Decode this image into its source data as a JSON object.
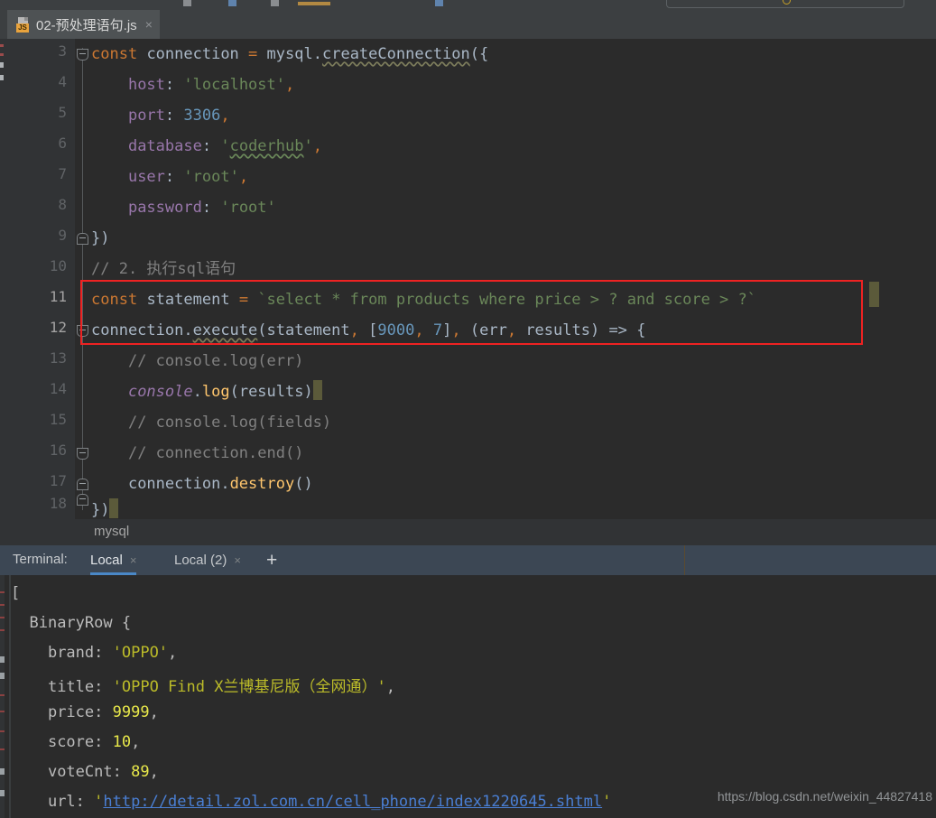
{
  "window": {
    "theme_bg": "#2b2b2b",
    "accent": "#4a88c7",
    "highlight_box_color": "#ee2222"
  },
  "tab": {
    "label": "02-预处理语句.js",
    "icon": "js-file-icon",
    "badge": "JS",
    "close": "×"
  },
  "editor": {
    "first_line_number": 3,
    "lines": [
      {
        "no": "3",
        "fold": "down",
        "text": "const connection = mysql.createConnection({"
      },
      {
        "no": "4",
        "fold": "",
        "text": "    host: 'localhost',"
      },
      {
        "no": "5",
        "fold": "",
        "text": "    port: 3306,"
      },
      {
        "no": "6",
        "fold": "",
        "text": "    database: 'coderhub',"
      },
      {
        "no": "7",
        "fold": "",
        "text": "    user: 'root',"
      },
      {
        "no": "8",
        "fold": "",
        "text": "    password: 'root'"
      },
      {
        "no": "9",
        "fold": "up",
        "text": "})"
      },
      {
        "no": "10",
        "fold": "",
        "text": "// 2. 执行sql语句"
      },
      {
        "no": "11",
        "fold": "",
        "text": "const statement = `select * from products where price > ? and score > ?`"
      },
      {
        "no": "12",
        "fold": "down",
        "text": "connection.execute(statement, [9000, 7], (err, results) => {"
      },
      {
        "no": "13",
        "fold": "",
        "text": "    // console.log(err)"
      },
      {
        "no": "14",
        "fold": "",
        "text": "    console.log(results)"
      },
      {
        "no": "15",
        "fold": "down",
        "text": "    // console.log(fields)"
      },
      {
        "no": "16",
        "fold": "up",
        "text": "    // connection.end()"
      },
      {
        "no": "17",
        "fold": "",
        "text": "    connection.destroy()"
      },
      {
        "no": "18",
        "fold": "up",
        "text": "})"
      }
    ],
    "highlighted_lines": [
      "11",
      "12"
    ]
  },
  "breadcrumb": {
    "label": "mysql"
  },
  "terminal_bar": {
    "label": "Terminal:",
    "tabs": [
      {
        "label": "Local",
        "close": "×",
        "active": true
      },
      {
        "label": "Local (2)",
        "close": "×",
        "active": false
      }
    ],
    "add_label": "+"
  },
  "terminal": {
    "lines": [
      "[",
      "  BinaryRow {",
      "    brand: 'OPPO',",
      "    title: 'OPPO Find X兰博基尼版（全网通）',",
      "    price: 9999,",
      "    score: 10,",
      "    voteCnt: 89,",
      "    url: 'http://detail.zol.com.cn/cell_phone/index1220645.shtml'"
    ],
    "row": {
      "class_name": "BinaryRow",
      "brand": "'OPPO'",
      "title": "'OPPO Find X兰博基尼版（全网通）'",
      "price": "9999",
      "score": "10",
      "voteCnt": "89",
      "url": "http://detail.zol.com.cn/cell_phone/index1220645.shtml"
    },
    "keys": [
      "brand:",
      "title:",
      "price:",
      "score:",
      "voteCnt:",
      "url:"
    ]
  },
  "watermark": {
    "text": "https://blog.csdn.net/weixin_44827418"
  }
}
